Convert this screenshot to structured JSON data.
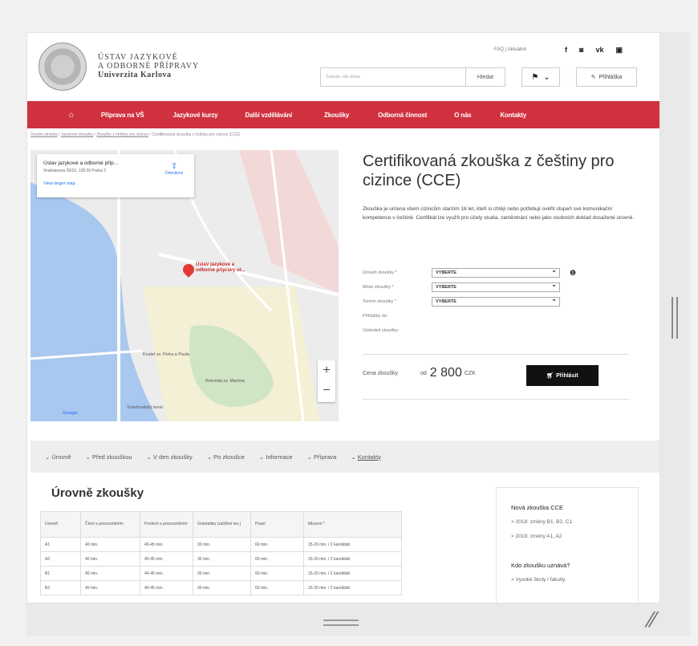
{
  "header": {
    "brand_line1": "ÚSTAV JAZYKOVÉ",
    "brand_line2": "A ODBORNÉ PŘÍPRAVY",
    "brand_line3": "Univerzita Karlova",
    "top_links": "FAQ  |  Aktuálně",
    "social_icons": [
      "facebook-icon",
      "instagram-icon",
      "vk-icon",
      "youtube-icon"
    ],
    "search_placeholder": "Zadejte váš dotaz",
    "search_button": "Hledat",
    "login_label": "Přihláška"
  },
  "nav": {
    "items": [
      "Příprava na VŠ",
      "Jazykové kurzy",
      "Další vzdělávání",
      "Zkoušky",
      "Odborná činnost",
      "O nás",
      "Kontakty"
    ],
    "accent": "#d0313e"
  },
  "breadcrumb": {
    "items": [
      "Úvodní stránka",
      "Jazykové zkoušky",
      "Zkoušky z češtiny pro cizince",
      "Certifikovaná zkouška z češtiny pro cizince (CCE)"
    ]
  },
  "map": {
    "card_title": "Ústav jazykové a odborné příp...",
    "card_address": "Vratislavova 29/10, 128 00 Praha 2",
    "card_link": "View larger map",
    "directions": "Directions",
    "pin_label": "Ústav jazykové a odborné přípravy ut...",
    "labels": [
      "Vyšehradský tunel",
      "Kostel sv. Petra a Pavla",
      "Rotunda sv. Martina",
      "Google"
    ]
  },
  "product": {
    "title": "Certifikovaná zkouška z češtiny pro cizince (CCE)",
    "description": "Zkouška je určena všem cizincům starším 16 let, kteří si chtějí nebo potřebují ověřit stupeň své komunikační kompetence v češtině. Certifikát lze využít pro účely studia, zaměstnání nebo jako osobních doklad dosažené úrovně.",
    "fields": [
      {
        "label": "Úroveň zkoušky *",
        "value": "VYBERTE"
      },
      {
        "label": "Místo zkoušky *",
        "value": "VYBERTE"
      },
      {
        "label": "Termín zkoušky *",
        "value": "VYBERTE"
      }
    ],
    "extra1": "Přihlášky do:",
    "extra2": "Výsledek zkoušky:",
    "price_label": "Cena zkoušky",
    "price_from": "od",
    "price_value": "2 800",
    "price_currency": "CZK",
    "buy_label": "Přihlásit"
  },
  "subnav": {
    "items": [
      "Úrovně",
      "Před zkouškou",
      "V den zkoušky",
      "Po zkoušce",
      "Informace",
      "Příprava",
      "Kontakty"
    ]
  },
  "levels": {
    "heading": "Úrovně zkoušky",
    "columns": [
      "Úroveň",
      "Čtení s porozuměním",
      "Poslech s porozuměním",
      "Gramatika (začlěné lex.)",
      "Psaní",
      "Mluvení *"
    ],
    "rows": [
      [
        "A1",
        "40 min.",
        "40-45 min.",
        "30 min.",
        "60 min.",
        "15-20 min. / 2 kandidáti"
      ],
      [
        "A2",
        "40 min.",
        "40-45 min.",
        "30 min.",
        "60 min.",
        "15-20 min. / 2 kandidáti"
      ],
      [
        "B1",
        "40 min.",
        "40-45 min.",
        "30 min.",
        "60 min.",
        "15-20 min. / 2 kandidáti"
      ],
      [
        "B2",
        "40 min.",
        "40-45 min.",
        "30 min.",
        "60 min.",
        "15-20 min. / 2 kandidáti"
      ]
    ]
  },
  "sidebar": {
    "title1": "Nová zkouška CCE",
    "links1": [
      "> 2018: změny B1, B2, C1",
      "> 2019: změny A1, A2"
    ],
    "title2": "Kdo zkoušku uznává?",
    "links2": [
      "> Vysoké školy / fakulty"
    ]
  }
}
